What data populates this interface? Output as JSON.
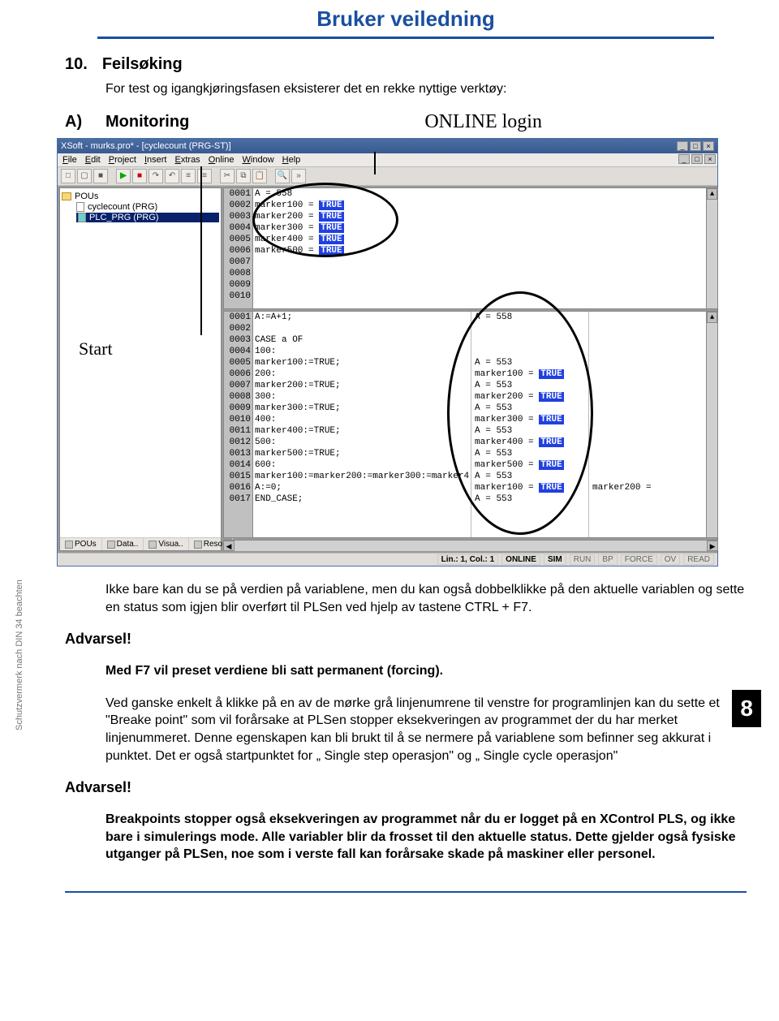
{
  "header_title": "Bruker veiledning",
  "section": {
    "num": "10.",
    "title": "Feilsøking"
  },
  "intro": "For test og igangkjøringsfasen eksisterer det en rekke nyttige verktøy:",
  "sub_letter": "A)",
  "sub_title": "Monitoring",
  "online_login_label": "ONLINE login",
  "start_label": "Start",
  "app": {
    "title": "XSoft - murks.pro* - [cyclecount (PRG-ST)]",
    "menus": [
      "File",
      "Edit",
      "Project",
      "Insert",
      "Extras",
      "Online",
      "Window",
      "Help"
    ],
    "tree_root": "POUs",
    "tree_items": [
      "cyclecount (PRG)",
      "PLC_PRG (PRG)"
    ],
    "tabs": [
      "POUs",
      "Data..",
      "Visua..",
      "Reso.."
    ],
    "top_a_line": "A = 558",
    "top_vars": [
      "marker100",
      "marker200",
      "marker300",
      "marker400",
      "marker500"
    ],
    "top_true": "TRUE",
    "bot_gutter": [
      "0001",
      "0002",
      "0003",
      "0004",
      "0005",
      "0006",
      "0007",
      "0008",
      "0009",
      "0010",
      "0011",
      "0012",
      "0013",
      "0014",
      "0015",
      "0016",
      "0017"
    ],
    "bot_code": [
      "A:=A+1;",
      "",
      "CASE a OF",
      "100:",
      "marker100:=TRUE;",
      "200:",
      "marker200:=TRUE;",
      "300:",
      "marker300:=TRUE;",
      "400:",
      "marker400:=TRUE;",
      "500:",
      "marker500:=TRUE;",
      "600:",
      "marker100:=marker200:=marker300:=marker4",
      "A:=0;",
      "END_CASE;"
    ],
    "bot_vals1": [
      "A = 558",
      "",
      "",
      "",
      "A = 553",
      "marker100 = ",
      "A = 553",
      "marker200 = ",
      "A = 553",
      "marker300 = ",
      "A = 553",
      "marker400 = ",
      "A = 553",
      "marker500 = ",
      "A = 553",
      "marker100 = ",
      "A = 553"
    ],
    "bot_trueflags1": [
      false,
      false,
      false,
      false,
      false,
      true,
      false,
      true,
      false,
      true,
      false,
      true,
      false,
      true,
      false,
      true,
      false
    ],
    "bot_vals2_last": "marker200 = ",
    "status": {
      "lincol": "Lin.: 1, Col.: 1",
      "online": "ONLINE",
      "sim": "SIM",
      "run": "RUN",
      "bp": "BP",
      "force": "FORCE",
      "ov": "OV",
      "read": "READ"
    }
  },
  "para1": "Ikke bare  kan du se på verdien på variablene, men du kan også dobbelklikke på den aktuelle variablen og sette en status som igjen blir overført til PLSen ved hjelp av tastene CTRL + F7.",
  "warn1": "Advarsel!",
  "warn1_body": "Med F7 vil preset verdiene bli satt permanent (forcing).",
  "para2": "Ved ganske enkelt å klikke på en av de mørke grå linjenumrene til venstre for programlinjen kan du sette et \"Breake point\" som vil forårsake at PLSen stopper eksekveringen av programmet der du har merket linjenummeret. Denne egenskapen kan bli brukt til å se nermere på variablene som befinner seg akkurat i punktet. Det er også startpunktet for „ Single step operasjon\" og „ Single cycle operasjon\"",
  "warn2": "Advarsel!",
  "warn2_body": "Breakpoints stopper også eksekveringen av programmet når du er logget på en XControl PLS, og ikke bare i simulerings mode. Alle variabler blir da frosset til den aktuelle status. Dette gjelder også fysiske utganger på PLSen, noe som i verste fall kan forårsake skade på maskiner eller personel.",
  "page_boxnum": "8",
  "side_note": "Schutzvermerk nach DIN 34 beachten"
}
